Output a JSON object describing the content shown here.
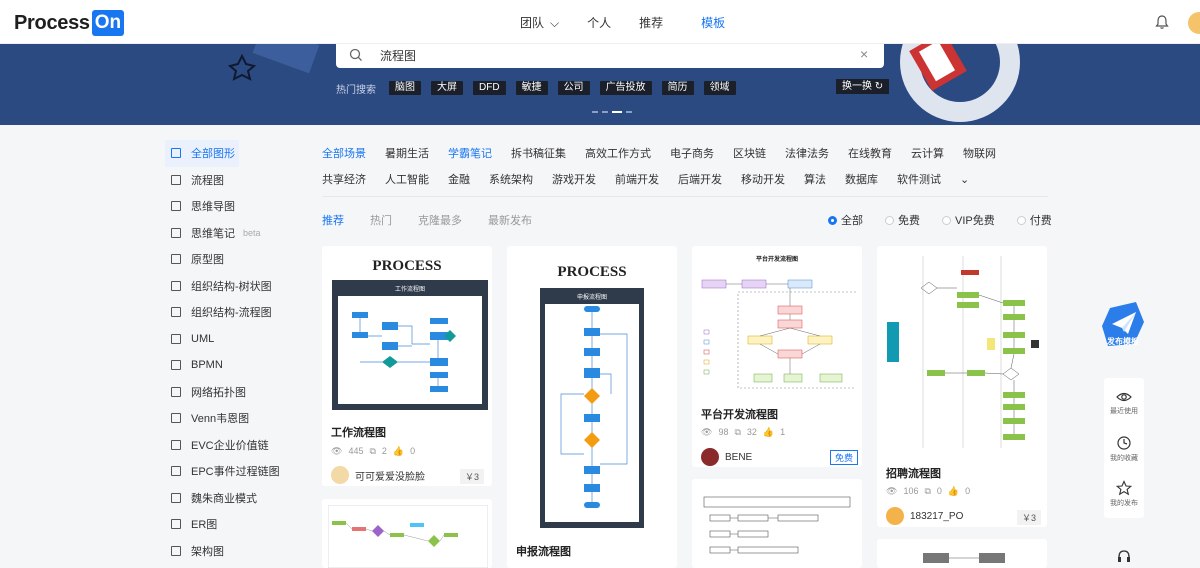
{
  "logo": {
    "text": "Process",
    "badge": "On"
  },
  "nav": {
    "items": [
      "团队",
      "个人",
      "推荐",
      "模板"
    ],
    "active": "模板"
  },
  "search": {
    "value": "流程图",
    "hot_label": "热门搜索",
    "hot_tags": [
      "脑图",
      "大屏",
      "DFD",
      "敏捷",
      "公司",
      "广告投放",
      "简历",
      "领域"
    ],
    "swap": "换一换"
  },
  "sidebar": {
    "items": [
      {
        "label": "全部图形",
        "active": true
      },
      {
        "label": "流程图"
      },
      {
        "label": "思维导图"
      },
      {
        "label": "思维笔记",
        "badge": "beta"
      },
      {
        "label": "原型图"
      },
      {
        "label": "组织结构-树状图"
      },
      {
        "label": "组织结构-流程图"
      },
      {
        "label": "UML"
      },
      {
        "label": "BPMN"
      },
      {
        "label": "网络拓扑图"
      },
      {
        "label": "Venn韦恩图"
      },
      {
        "label": "EVC企业价值链"
      },
      {
        "label": "EPC事件过程链图"
      },
      {
        "label": "魏朱商业模式"
      },
      {
        "label": "ER图"
      },
      {
        "label": "架构图"
      }
    ]
  },
  "categories": {
    "row1": [
      "全部场景",
      "暑期生活",
      "学霸笔记",
      "拆书稿征集",
      "高效工作方式",
      "电子商务",
      "区块链",
      "法律法务",
      "在线教育",
      "云计算",
      "物联网"
    ],
    "row2": [
      "共享经济",
      "人工智能",
      "金融",
      "系统架构",
      "游戏开发",
      "前端开发",
      "后端开发",
      "移动开发",
      "算法",
      "数据库",
      "软件测试"
    ],
    "active": [
      "全部场景",
      "学霸笔记"
    ],
    "more": "⌄"
  },
  "tabs": [
    "推荐",
    "热门",
    "克隆最多",
    "最新发布"
  ],
  "filters": [
    "全部",
    "免费",
    "VIP免费",
    "付费"
  ],
  "cards": [
    {
      "thumb_title": "PROCESS",
      "thumb_sub": "工作流程图",
      "title": "工作流程图",
      "views": "445",
      "clones": "2",
      "likes": "0",
      "user": "可可爱爱没脸脸",
      "price": "￥3"
    },
    {
      "thumb_title": "PROCESS",
      "thumb_sub": "申报流程图",
      "title": "申报流程图"
    },
    {
      "thumb_title": "平台开发流程图",
      "title": "平台开发流程图",
      "views": "98",
      "clones": "32",
      "likes": "1",
      "user": "BENE",
      "tag": "免费"
    },
    {
      "thumb_title": "招聘流程图",
      "title": "招聘流程图",
      "views": "106",
      "clones": "0",
      "likes": "0",
      "user": "183217_PO",
      "price": "￥3"
    }
  ],
  "right_tools": {
    "publish": "发布模板",
    "recent": "最近使用",
    "favorites": "我的收藏",
    "published": "我的发布"
  },
  "colors": {
    "accent": "#1976f1",
    "banner": "#2c4a82"
  }
}
